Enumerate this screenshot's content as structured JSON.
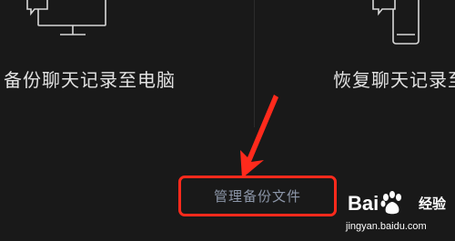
{
  "options": {
    "left_label": "备份聊天记录至电脑",
    "right_label": "恢复聊天记录至"
  },
  "manage_link": "管理备份文件",
  "watermark": {
    "logo_left": "Bai",
    "logo_right": "经验",
    "url": "jingyan.baidu.com"
  },
  "colors": {
    "background": "#191919",
    "highlight": "#ff2a1c",
    "link_text": "#8c96a8",
    "label_text": "#e2e2e2"
  },
  "icons": [
    "computer-chat-icon",
    "phone-chat-icon",
    "red-pointer-arrow",
    "baidu-paw-icon"
  ]
}
